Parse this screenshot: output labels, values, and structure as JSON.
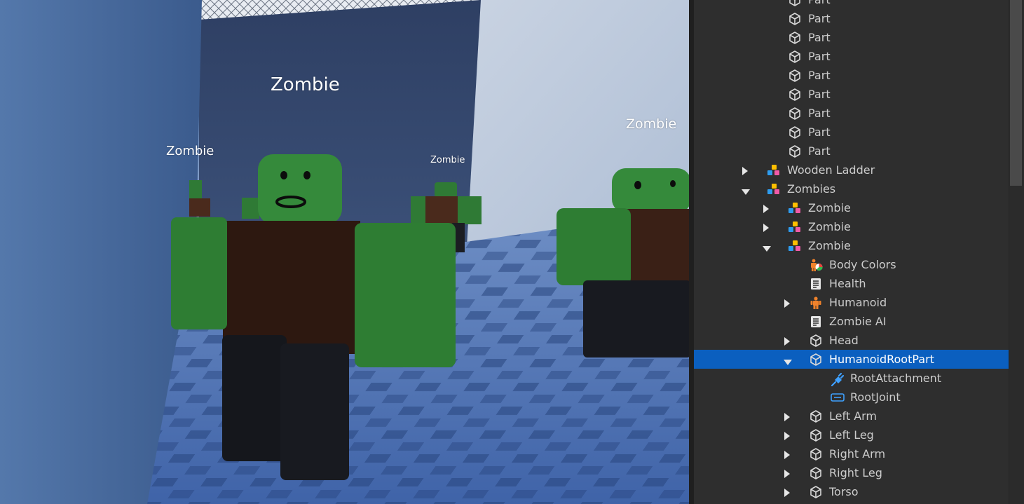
{
  "viewport": {
    "billboards": [
      "Zombie",
      "Zombie",
      "Zombie",
      "Zombie"
    ]
  },
  "explorer": {
    "rows": [
      {
        "label": "Part",
        "icon": "part-icon",
        "depth": 4,
        "arrow": "none",
        "selected": false
      },
      {
        "label": "Part",
        "icon": "part-icon",
        "depth": 4,
        "arrow": "none",
        "selected": false
      },
      {
        "label": "Part",
        "icon": "part-icon",
        "depth": 4,
        "arrow": "none",
        "selected": false
      },
      {
        "label": "Part",
        "icon": "part-icon",
        "depth": 4,
        "arrow": "none",
        "selected": false
      },
      {
        "label": "Part",
        "icon": "part-icon",
        "depth": 4,
        "arrow": "none",
        "selected": false
      },
      {
        "label": "Part",
        "icon": "part-icon",
        "depth": 4,
        "arrow": "none",
        "selected": false
      },
      {
        "label": "Part",
        "icon": "part-icon",
        "depth": 4,
        "arrow": "none",
        "selected": false
      },
      {
        "label": "Part",
        "icon": "part-icon",
        "depth": 4,
        "arrow": "none",
        "selected": false
      },
      {
        "label": "Part",
        "icon": "part-icon",
        "depth": 4,
        "arrow": "none",
        "selected": false
      },
      {
        "label": "Wooden Ladder",
        "icon": "model-icon",
        "depth": 3,
        "arrow": "collapsed",
        "selected": false
      },
      {
        "label": "Zombies",
        "icon": "model-icon",
        "depth": 3,
        "arrow": "expanded",
        "selected": false
      },
      {
        "label": "Zombie",
        "icon": "model-icon",
        "depth": 4,
        "arrow": "collapsed",
        "selected": false
      },
      {
        "label": "Zombie",
        "icon": "model-icon",
        "depth": 4,
        "arrow": "collapsed",
        "selected": false
      },
      {
        "label": "Zombie",
        "icon": "model-icon",
        "depth": 4,
        "arrow": "expanded",
        "selected": false
      },
      {
        "label": "Body Colors",
        "icon": "body-colors-icon",
        "depth": 5,
        "arrow": "none",
        "selected": false
      },
      {
        "label": "Health",
        "icon": "script-icon",
        "depth": 5,
        "arrow": "none",
        "selected": false
      },
      {
        "label": "Humanoid",
        "icon": "humanoid-icon",
        "depth": 5,
        "arrow": "collapsed",
        "selected": false
      },
      {
        "label": "Zombie AI",
        "icon": "script-icon",
        "depth": 5,
        "arrow": "none",
        "selected": false
      },
      {
        "label": "Head",
        "icon": "part-icon",
        "depth": 5,
        "arrow": "collapsed",
        "selected": false
      },
      {
        "label": "HumanoidRootPart",
        "icon": "part-icon",
        "depth": 5,
        "arrow": "expanded",
        "selected": true
      },
      {
        "label": "RootAttachment",
        "icon": "attachment-icon",
        "depth": 6,
        "arrow": "none",
        "selected": false
      },
      {
        "label": "RootJoint",
        "icon": "joint-icon",
        "depth": 6,
        "arrow": "none",
        "selected": false
      },
      {
        "label": "Left Arm",
        "icon": "part-icon",
        "depth": 5,
        "arrow": "collapsed",
        "selected": false
      },
      {
        "label": "Left Leg",
        "icon": "part-icon",
        "depth": 5,
        "arrow": "collapsed",
        "selected": false
      },
      {
        "label": "Right Arm",
        "icon": "part-icon",
        "depth": 5,
        "arrow": "collapsed",
        "selected": false
      },
      {
        "label": "Right Leg",
        "icon": "part-icon",
        "depth": 5,
        "arrow": "collapsed",
        "selected": false
      },
      {
        "label": "Torso",
        "icon": "part-icon",
        "depth": 5,
        "arrow": "collapsed",
        "selected": false
      }
    ]
  },
  "colors": {
    "selection": "#0b5fbf",
    "panel_bg": "#2e2e2e",
    "text": "#cccccc",
    "zombie_skin": "#3a8a3e",
    "zombie_shirt": "#3a1f14",
    "zombie_pants": "#1b1d22"
  }
}
